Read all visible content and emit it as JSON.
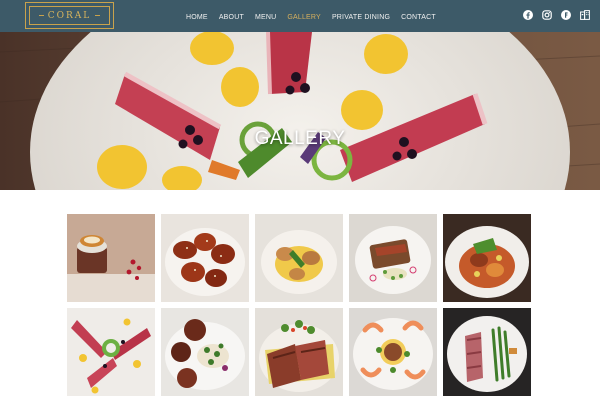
{
  "brand": {
    "name": "CORAL"
  },
  "nav": {
    "items": [
      {
        "label": "HOME",
        "active": false
      },
      {
        "label": "ABOUT",
        "active": false
      },
      {
        "label": "MENU",
        "active": false
      },
      {
        "label": "GALLERY",
        "active": true
      },
      {
        "label": "PRIVATE DINING",
        "active": false
      },
      {
        "label": "CONTACT",
        "active": false
      }
    ]
  },
  "social": {
    "icons": [
      "facebook-icon",
      "instagram-icon",
      "tripadvisor-icon",
      "building-icon"
    ]
  },
  "hero": {
    "title": "GALLERY"
  },
  "gallery": {
    "items": [
      {
        "name": "gallery-image-dessert"
      },
      {
        "name": "gallery-image-glazed-wings"
      },
      {
        "name": "gallery-image-plated-entree"
      },
      {
        "name": "gallery-image-fish-toast"
      },
      {
        "name": "gallery-image-braised-bowl"
      },
      {
        "name": "gallery-image-tuna-tataki"
      },
      {
        "name": "gallery-image-scallops-greens"
      },
      {
        "name": "gallery-image-sliced-steak"
      },
      {
        "name": "gallery-image-shrimp-plate"
      },
      {
        "name": "gallery-image-duck-asparagus"
      }
    ]
  },
  "colors": {
    "header_bg": "#3d5a68",
    "nav_text": "#f1f1f1",
    "nav_active": "#d7b05d",
    "logo_gold": "#c9a24c"
  }
}
